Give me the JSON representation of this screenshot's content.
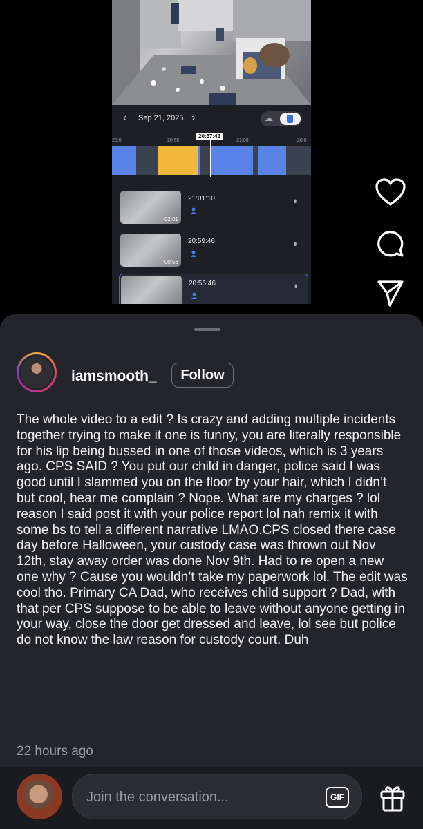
{
  "video": {
    "date": "Sep 21, 2025",
    "current_time": "20:57:43",
    "ruler_labels": [
      "20:55",
      "21:00",
      "20:0"
    ],
    "clips": [
      {
        "time": "21:01:10",
        "duration": "02:01",
        "selected": false
      },
      {
        "time": "20:59:46",
        "duration": "00:56",
        "selected": false
      },
      {
        "time": "20:56:46",
        "duration": "",
        "selected": true
      }
    ],
    "segment_colors": {
      "motion": "#5a83e8",
      "person": "#f0b93a",
      "empty": "#3a4150"
    }
  },
  "side_actions": [
    "heart-icon",
    "comment-icon",
    "share-icon"
  ],
  "comment": {
    "username": "iamsmooth_",
    "follow_label": "Follow",
    "text": "The whole video to a edit ? Is crazy and adding multiple incidents together trying to make it one is funny, you are literally responsible for his lip being bussed in one of those videos, which is 3 years ago. CPS SAID ? You put our child in danger, police said I was good until I slammed you on the floor by your hair, which I didn’t but cool, hear me complain ? Nope. What are my charges ? lol reason I said post it with your police report lol nah remix it with some bs to tell a different narrative LMAO.CPS closed there case day before Halloween, your custody case was thrown out Nov 12th, stay away order was done  Nov 9th. Had to re open a new one why ? Cause you wouldn’t take my paperwork lol. The edit was cool tho. Primary CA Dad, who receives child support ? Dad, with that per CPS suppose to be able to leave without anyone getting in your way, close the door get dressed and leave, lol see but police do not know the law reason for custody court. Duh",
    "time_ago": "22 hours ago"
  },
  "composer": {
    "placeholder": "Join the conversation...",
    "gif_label": "GIF"
  }
}
